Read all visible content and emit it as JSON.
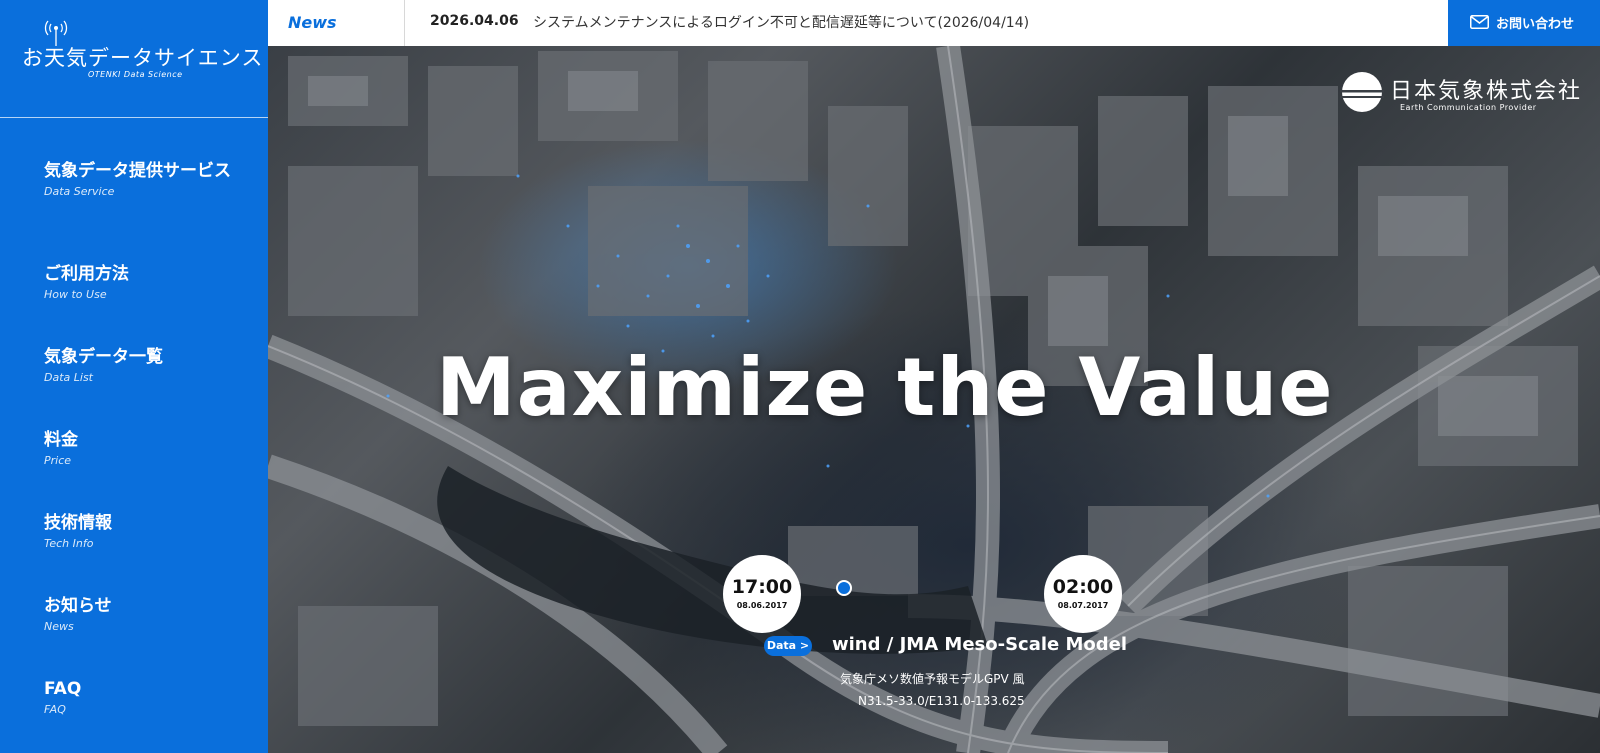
{
  "sidebar": {
    "logo_title": "お天気データサイエンス",
    "logo_sub": "OTENKI Data Science",
    "items": [
      {
        "label": "気象データ提供サービス",
        "sub": "Data Service"
      },
      {
        "label": "ご利用方法",
        "sub": "How to Use"
      },
      {
        "label": "気象データ一覧",
        "sub": "Data List"
      },
      {
        "label": "料金",
        "sub": "Price"
      },
      {
        "label": "技術情報",
        "sub": "Tech Info"
      },
      {
        "label": "お知らせ",
        "sub": "News"
      },
      {
        "label": "FAQ",
        "sub": "FAQ"
      }
    ]
  },
  "newsbar": {
    "tag": "News",
    "date": "2026.04.06",
    "text": "システムメンテナンスによるログイン不可と配信遅延等について(2026/04/14)",
    "contact_label": "お問い合わせ"
  },
  "brand": {
    "name": "日本気象株式会社",
    "sub": "Earth Communication Provider"
  },
  "hero": {
    "title": "Maximize the Value",
    "time_start": {
      "time": "17:00",
      "date": "08.06.2017"
    },
    "time_end": {
      "time": "02:00",
      "date": "08.07.2017"
    },
    "data_badge": "Data >",
    "data_title": "wind / JMA Meso-Scale Model",
    "data_jp": "気象庁メソ数値予報モデルGPV 風",
    "data_coord": "N31.5-33.0/E131.0-133.625"
  },
  "colors": {
    "accent": "#0a6fdc",
    "white": "#ffffff"
  }
}
